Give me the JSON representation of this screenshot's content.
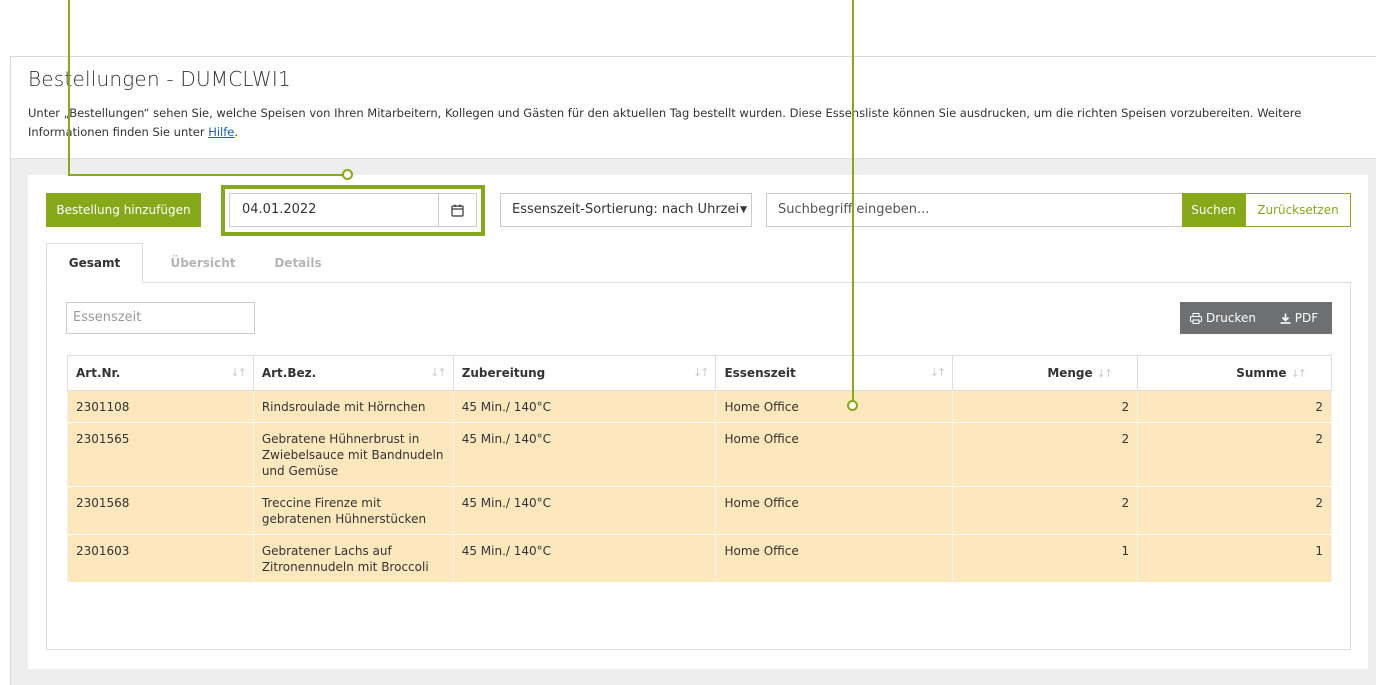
{
  "page": {
    "title": "Bestellungen - DUMCLWI1",
    "description_pre": "Unter „Bestellungen“ sehen Sie, welche Speisen von Ihren Mitarbeitern, Kollegen und Gästen für den aktuellen Tag bestellt wurden. Diese Essensliste können Sie ausdrucken, um die richten Speisen vorzubereiten. Weitere Informationen finden Sie unter ",
    "help_link": "Hilfe",
    "description_post": "."
  },
  "toolbar": {
    "add_label": "Bestellung hinzufügen",
    "date_value": "04.01.2022",
    "sort_label": "Essenszeit-Sortierung: nach Uhrzeit",
    "search_placeholder": "Suchbegriff eingeben...",
    "search_label": "Suchen",
    "reset_label": "Zurücksetzen"
  },
  "tabs": [
    {
      "label": "Gesamt",
      "active": true
    },
    {
      "label": "Übersicht",
      "active": false
    },
    {
      "label": "Details",
      "active": false
    }
  ],
  "filter": {
    "placeholder": "Essenszeit"
  },
  "actions": {
    "print_label": "Drucken",
    "pdf_label": "PDF"
  },
  "table": {
    "headers": [
      "Art.Nr.",
      "Art.Bez.",
      "Zubereitung",
      "Essenszeit",
      "Menge",
      "Summe"
    ],
    "rows": [
      [
        "2301108",
        "Rindsroulade mit Hörnchen",
        "45 Min./ 140°C",
        "Home Office",
        "2",
        "2"
      ],
      [
        "2301565",
        "Gebratene Hühnerbrust in Zwiebelsauce mit Bandnudeln und Gemüse",
        "45 Min./ 140°C",
        "Home Office",
        "2",
        "2"
      ],
      [
        "2301568",
        "Treccine Firenze mit gebratenen Hühnerstücken",
        "45 Min./ 140°C",
        "Home Office",
        "2",
        "2"
      ],
      [
        "2301603",
        "Gebratener Lachs auf Zitronennudeln mit Broccoli",
        "45 Min./ 140°C",
        "Home Office",
        "1",
        "1"
      ]
    ]
  },
  "colors": {
    "accent": "#86a91a",
    "row_highlight": "#fde8bd",
    "dark_button": "#6d6f71"
  },
  "icons": [
    "calendar-icon",
    "caret-down-icon",
    "printer-icon",
    "download-icon",
    "sort-icon"
  ]
}
